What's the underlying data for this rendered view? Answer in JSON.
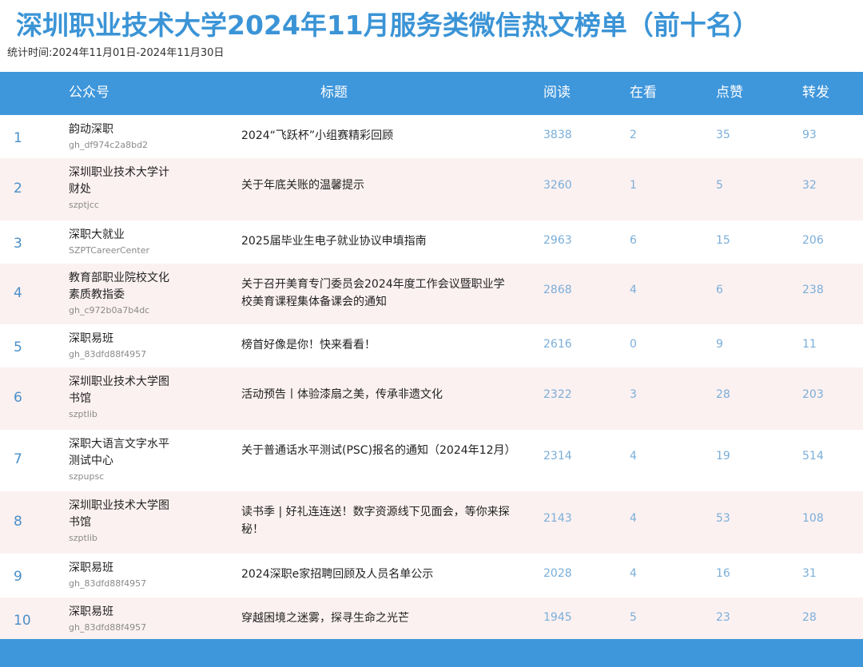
{
  "title": "深圳职业技术大学2024年11月服务类微信热文榜单（前十名）",
  "period": "统计时间:2024年11月01日-2024年11月30日",
  "colors": {
    "accent": "#3e96db",
    "title": "#3b94d6",
    "stripe": "#fcf1f1",
    "number": "#7aaed9"
  },
  "table": {
    "headers": {
      "account": "公众号",
      "title": "标题",
      "reads": "阅读",
      "watching": "在看",
      "likes": "点赞",
      "shares": "转发"
    },
    "rows": [
      {
        "rank": "1",
        "account": "韵动深职",
        "account_id": "gh_df974c2a8bd2",
        "title": "2024“飞跃杯”小组赛精彩回顾",
        "reads": "3838",
        "watching": "2",
        "likes": "35",
        "shares": "93"
      },
      {
        "rank": "2",
        "account": "深圳职业技术大学计财处",
        "account_id": "szptjcc",
        "title": "关于年底关账的温馨提示",
        "reads": "3260",
        "watching": "1",
        "likes": "5",
        "shares": "32"
      },
      {
        "rank": "3",
        "account": "深职大就业",
        "account_id": "SZPTCareerCenter",
        "title": "2025届毕业生电子就业协议申填指南",
        "reads": "2963",
        "watching": "6",
        "likes": "15",
        "shares": "206"
      },
      {
        "rank": "4",
        "account": "教育部职业院校文化素质教指委",
        "account_id": "gh_c972b0a7b4dc",
        "title": "关于召开美育专门委员会2024年度工作会议暨职业学校美育课程集体备课会的通知",
        "reads": "2868",
        "watching": "4",
        "likes": "6",
        "shares": "238"
      },
      {
        "rank": "5",
        "account": "深职易班",
        "account_id": "gh_83dfd88f4957",
        "title": "榜首好像是你！快来看看！",
        "reads": "2616",
        "watching": "0",
        "likes": "9",
        "shares": "11"
      },
      {
        "rank": "6",
        "account": "深圳职业技术大学图书馆",
        "account_id": "szptlib",
        "title": "活动预告丨体验漆扇之美，传承非遗文化",
        "reads": "2322",
        "watching": "3",
        "likes": "28",
        "shares": "203"
      },
      {
        "rank": "7",
        "account": "深职大语言文字水平测试中心",
        "account_id": "szpupsc",
        "title": "关于普通话水平测试(PSC)报名的通知（2024年12月）",
        "reads": "2314",
        "watching": "4",
        "likes": "19",
        "shares": "514"
      },
      {
        "rank": "8",
        "account": "深圳职业技术大学图书馆",
        "account_id": "szptlib",
        "title": "读书季 | 好礼连连送！数字资源线下见面会，等你来探秘！",
        "reads": "2143",
        "watching": "4",
        "likes": "53",
        "shares": "108"
      },
      {
        "rank": "9",
        "account": "深职易班",
        "account_id": "gh_83dfd88f4957",
        "title": "2024深职e家招聘回顾及人员名单公示",
        "reads": "2028",
        "watching": "4",
        "likes": "16",
        "shares": "31"
      },
      {
        "rank": "10",
        "account": "深职易班",
        "account_id": "gh_83dfd88f4957",
        "title": "穿越困境之迷雾，探寻生命之光芒",
        "reads": "1945",
        "watching": "5",
        "likes": "23",
        "shares": "28"
      }
    ]
  }
}
